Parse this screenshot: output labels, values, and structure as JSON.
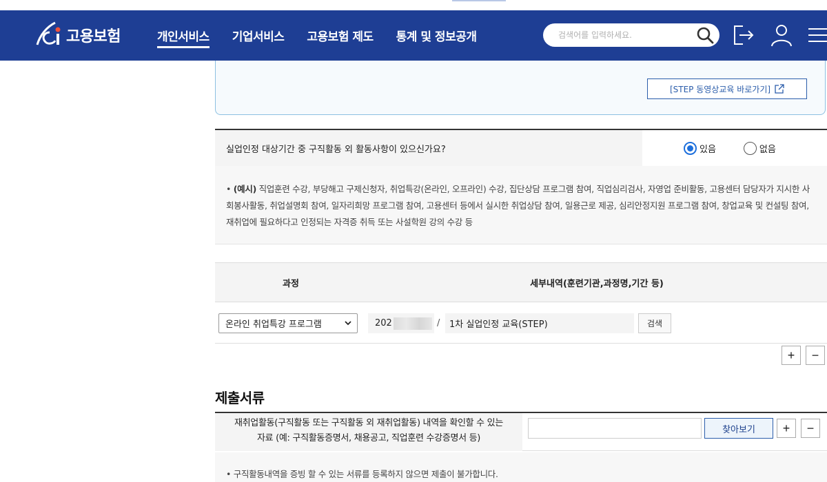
{
  "header": {
    "logo_text": "고용보험",
    "nav": [
      "개인서비스",
      "기업서비스",
      "고용보험 제도",
      "통계 및 정보공개"
    ],
    "active_nav": "개인서비스",
    "search_placeholder": "검색어를 입력하세요."
  },
  "step": {
    "button_label": "[STEP 동영상교육 바로가기]"
  },
  "question": {
    "text": "실업인정 대상기간 중 구직활동 외 활동사항이 있으신가요?",
    "options": [
      "있음",
      "없음"
    ],
    "selected": "있음"
  },
  "examples": {
    "prefix": "(예시)",
    "text": " 직업훈련 수강, 부당해고 구제신청자, 취업특강(온라인, 오프라인) 수강, 집단상담 프로그램 참여, 직업심리검사, 자영업 준비활동, 고용센터 담당자가 지시한 사회봉사활동, 취업설명회 참여, 일자리희망 프로그램 참여, 고용센터 등에서 실시한 취업상담 참여, 일용근로 제공, 심리안정지원 프로그램 참여, 창업교육 및 컨설팅 참여, 재취업에 필요하다고 인정되는 자격증 취득 또는 사설학원 강의 수강 등"
  },
  "table": {
    "headers": [
      "과정",
      "세부내역(훈련기관,과정명,기간 등)"
    ],
    "row": {
      "course": "온라인 취업특강 프로그램",
      "date_prefix": "202",
      "separator": "/",
      "detail": "1차 실업인정 교육(STEP)",
      "search_label": "검색"
    },
    "add_label": "+",
    "remove_label": "−"
  },
  "documents": {
    "title": "제출서류",
    "label_line1": "재취업활동(구직활동 또는 구직활동 외 재취업활동) 내역을 확인할 수 있는",
    "label_line2": "자료 (예: 구직활동증명서, 채용공고, 직업훈련 수강증명서 등)",
    "browse_label": "찾아보기",
    "add_label": "+",
    "remove_label": "−",
    "notice": "구직활동내역을 증빙 할 수 있는 서류를 등록하지 않으면 제출이 불가합니다."
  },
  "colors": {
    "header_bg": "#1e3e94",
    "accent_blue": "#2a5caa",
    "radio_selected": "#1d6fdc"
  }
}
